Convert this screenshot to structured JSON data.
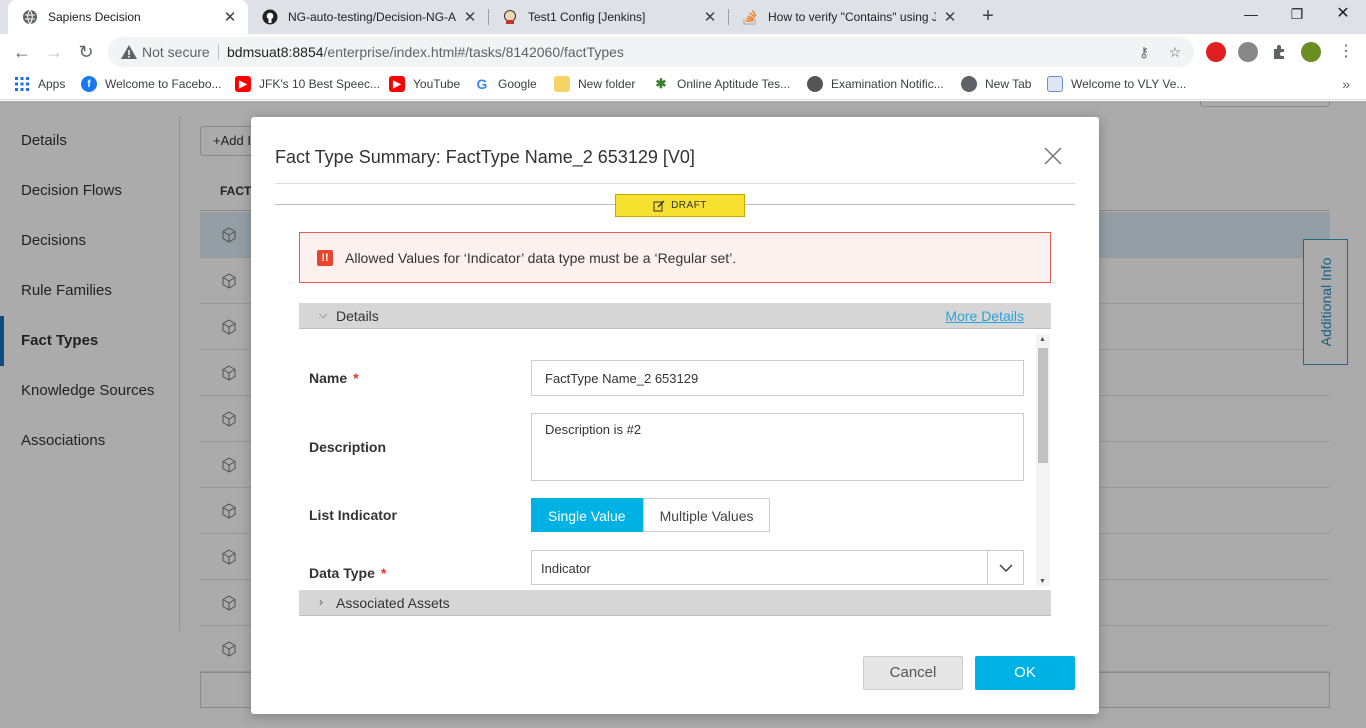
{
  "browser": {
    "tabs": [
      {
        "title": "Sapiens Decision",
        "icon": "globe-icon",
        "active": true
      },
      {
        "title": "NG-auto-testing/Decision-NG-A",
        "icon": "github-icon",
        "active": false
      },
      {
        "title": "Test1 Config [Jenkins]",
        "icon": "jenkins-icon",
        "active": false
      },
      {
        "title": "How to verify \"Contains\" using Ja",
        "icon": "stackoverflow-icon",
        "active": false
      }
    ],
    "omnibox": {
      "security": "Not secure",
      "url_host": "bdmsuat8:8854",
      "url_path": "/enterprise/index.html#/tasks/8142060/factTypes"
    },
    "bookmarks": [
      {
        "label": "Apps",
        "icon": "apps-grid-icon",
        "color": "#4285f4"
      },
      {
        "label": "Welcome to Facebo...",
        "icon": "facebook-icon",
        "color": "#1877f2"
      },
      {
        "label": "JFK's 10 Best Speec...",
        "icon": "youtube-icon",
        "color": "#ff0000"
      },
      {
        "label": "YouTube",
        "icon": "youtube-icon",
        "color": "#ff0000"
      },
      {
        "label": "Google",
        "icon": "google-icon",
        "color": "#4285f4"
      },
      {
        "label": "New folder",
        "icon": "folder-icon",
        "color": "#f6d365"
      },
      {
        "label": "Online Aptitude Tes...",
        "icon": "palm-icon",
        "color": "#3a7d2c"
      },
      {
        "label": "Examination Notific...",
        "icon": "emblem-icon",
        "color": "#555555"
      },
      {
        "label": "New Tab",
        "icon": "globe-icon",
        "color": "#5f6368"
      },
      {
        "label": "Welcome to VLY Ve...",
        "icon": "doc-icon",
        "color": "#6b8fd6"
      }
    ]
  },
  "sidebar": {
    "items": [
      {
        "label": "Details"
      },
      {
        "label": "Decision Flows"
      },
      {
        "label": "Decisions"
      },
      {
        "label": "Rule Families"
      },
      {
        "label": "Fact Types"
      },
      {
        "label": "Knowledge Sources"
      },
      {
        "label": "Associations"
      }
    ],
    "active_index": 4
  },
  "background": {
    "add_button": "+Add I",
    "grid_header": "FACT",
    "additional_info": "Additional Info"
  },
  "modal": {
    "title": "Fact Type Summary: FactType Name_2 653129 [V0]",
    "status_badge": "DRAFT",
    "alert": {
      "icon": "!!",
      "message": "Allowed Values for ‘Indicator’ data type must be a ‘Regular set’."
    },
    "details_section": {
      "title": "Details",
      "more_link": "More Details"
    },
    "form": {
      "name_label": "Name",
      "name_required": "*",
      "name_value": "FactType Name_2 653129",
      "description_label": "Description",
      "description_value": "Description is #2",
      "list_indicator_label": "List Indicator",
      "list_options": [
        "Single Value",
        "Multiple Values"
      ],
      "list_selected": "Single Value",
      "data_type_label": "Data Type",
      "data_type_required": "*",
      "data_type_value": "Indicator"
    },
    "assets_section": {
      "title": "Associated Assets"
    },
    "buttons": {
      "cancel": "Cancel",
      "ok": "OK"
    },
    "colors": {
      "primary": "#00b2e3",
      "draft": "#f7e12f",
      "error": "#e55b4f",
      "link": "#2aa3d6"
    }
  }
}
